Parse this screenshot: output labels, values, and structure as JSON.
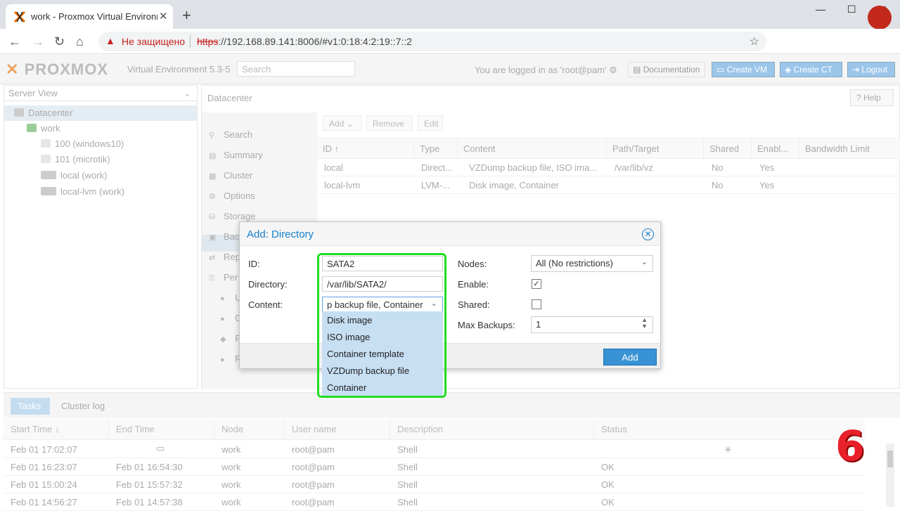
{
  "browser": {
    "tab_title": "work - Proxmox Virtual Environm",
    "close_tab": "✕",
    "new_tab": "+",
    "insecure_label": "Не защищено",
    "url_scheme": "https",
    "url_rest": "://192.168.89.141:8006/#v1:0:18:4:2:19::7::2"
  },
  "header": {
    "logo": "PROXMOX",
    "version": "Virtual Environment 5.3-5",
    "search_placeholder": "Search",
    "logged_in": "You are logged in as 'root@pam'",
    "documentation": "Documentation",
    "create_vm": "Create VM",
    "create_ct": "Create CT",
    "logout": "Logout"
  },
  "tree": {
    "view": "Server View",
    "nodes": [
      {
        "label": "Datacenter"
      },
      {
        "label": "work"
      },
      {
        "label": "100 (windows10)"
      },
      {
        "label": "101 (microtik)"
      },
      {
        "label": "local (work)"
      },
      {
        "label": "local-lvm (work)"
      }
    ]
  },
  "content": {
    "breadcrumb": "Datacenter",
    "help": "Help",
    "nav": [
      "Search",
      "Summary",
      "Cluster",
      "Options",
      "Storage",
      "Bac",
      "Rep",
      "Per",
      "U",
      "G",
      "P",
      "R"
    ],
    "toolbar": {
      "add": "Add",
      "remove": "Remove",
      "edit": "Edit"
    },
    "columns": [
      "ID",
      "Type",
      "Content",
      "Path/Target",
      "Shared",
      "Enabl...",
      "Bandwidth Limit"
    ],
    "rows": [
      [
        "local",
        "Direct...",
        "VZDump backup file, ISO ima...",
        "/var/lib/vz",
        "No",
        "Yes"
      ],
      [
        "local-lvm",
        "LVM-...",
        "Disk image, Container",
        "",
        "No",
        "Yes"
      ]
    ]
  },
  "dialog": {
    "title": "Add: Directory",
    "id_label": "ID:",
    "id_value": "SATA2",
    "dir_label": "Directory:",
    "dir_value": "/var/lib/SATA2/",
    "content_label": "Content:",
    "content_value": "p backup file, Container",
    "nodes_label": "Nodes:",
    "nodes_value": "All (No restrictions)",
    "enable_label": "Enable:",
    "enable_checked": true,
    "shared_label": "Shared:",
    "shared_checked": false,
    "maxbackups_label": "Max Backups:",
    "maxbackups_value": "1",
    "add_button": "Add",
    "content_options": [
      "Disk image",
      "ISO image",
      "Container template",
      "VZDump backup file",
      "Container"
    ]
  },
  "tasks": {
    "tab_tasks": "Tasks",
    "tab_cluster_log": "Cluster log",
    "columns": [
      "Start Time",
      "End Time",
      "Node",
      "User name",
      "Description",
      "Status"
    ],
    "rows": [
      [
        "Feb 01 17:02:07",
        "",
        "work",
        "root@pam",
        "Shell",
        ""
      ],
      [
        "Feb 01 16:23:07",
        "Feb 01 16:54:30",
        "work",
        "root@pam",
        "Shell",
        "OK"
      ],
      [
        "Feb 01 15:00:24",
        "Feb 01 15:57:32",
        "work",
        "root@pam",
        "Shell",
        "OK"
      ],
      [
        "Feb 01 14:56:27",
        "Feb 01 14:57:38",
        "work",
        "root@pam",
        "Shell",
        "OK"
      ]
    ]
  },
  "overlay_number": "6",
  "colors": {
    "accent": "#157fcc",
    "highlight": "#22dd22",
    "badge": "#e8202a"
  }
}
